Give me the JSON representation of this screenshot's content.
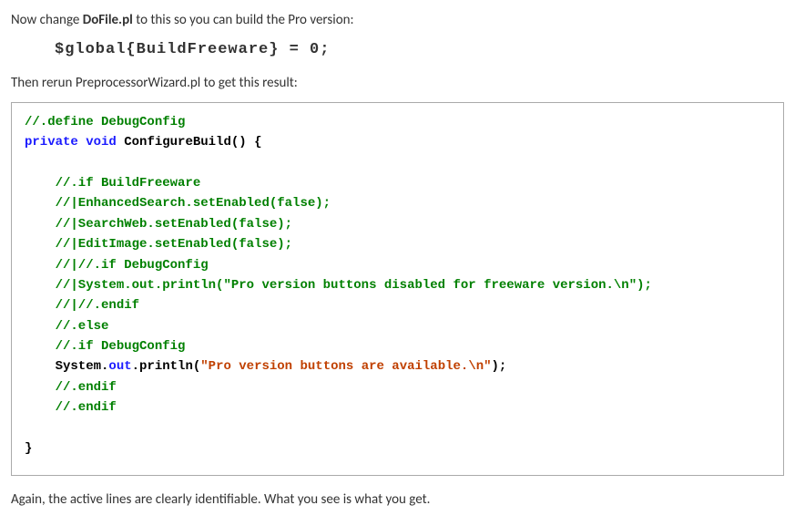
{
  "intro": {
    "pre": "Now change ",
    "filename": "DoFile.pl",
    "post": " to this so you can build the Pro version:"
  },
  "globalLine": "$global{BuildFreeware} = 0;",
  "rerun": {
    "pre": "Then rerun ",
    "tool": "PreprocessorWizard.pl",
    "post": " to get this result:"
  },
  "code": {
    "l1": "//.define DebugConfig",
    "l2_kw1": "private",
    "l2_sp1": " ",
    "l2_kw2": "void",
    "l2_sp2": " ",
    "l2_name": "ConfigureBuild",
    "l2_tail": "() {",
    "blank1": "",
    "l3": "    //.if BuildFreeware",
    "l4": "    //|EnhancedSearch.setEnabled(false);",
    "l5": "    //|SearchWeb.setEnabled(false);",
    "l6": "    //|EditImage.setEnabled(false);",
    "l7": "    //|//.if DebugConfig",
    "l8a": "    //|System.out.println(",
    "l8b": "\"Pro version buttons disabled for freeware version.\\n\"",
    "l8c": ");",
    "l9": "    //|//.endif",
    "l10": "    //.else",
    "l11": "    //.if DebugConfig",
    "l12a": "    System",
    "l12b": ".",
    "l12c": "out",
    "l12d": ".",
    "l12e": "println",
    "l12f": "(",
    "l12g": "\"Pro version buttons are available.\\n\"",
    "l12h": ");",
    "l13": "    //.endif",
    "l14": "    //.endif",
    "blank2": "",
    "l15": "}"
  },
  "outro": "Again, the active lines are clearly identifiable.  What you see is what you get."
}
